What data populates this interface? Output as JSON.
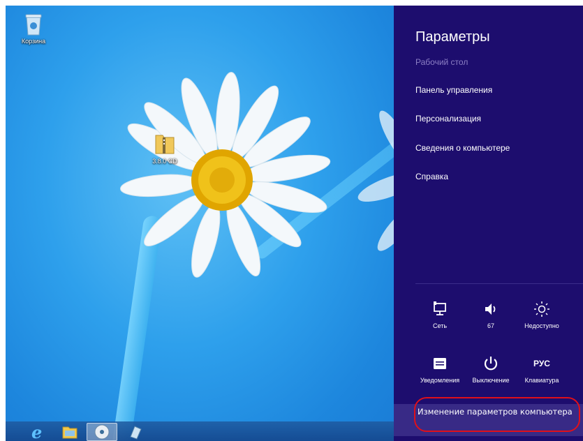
{
  "desktop": {
    "icons": [
      {
        "label": "Корзина"
      },
      {
        "label": "3.8.0 CD"
      }
    ]
  },
  "charm": {
    "title": "Параметры",
    "context": "Рабочий стол",
    "links": [
      "Панель управления",
      "Персонализация",
      "Сведения о компьютере",
      "Справка"
    ],
    "tiles": [
      {
        "label": "Сеть",
        "icon": "network-icon"
      },
      {
        "label": "67",
        "icon": "volume-icon"
      },
      {
        "label": "Недоступно",
        "icon": "brightness-icon"
      },
      {
        "label": "Уведомления",
        "icon": "notifications-icon"
      },
      {
        "label": "Выключение",
        "icon": "power-icon"
      },
      {
        "label": "Клавиатура",
        "icon": "keyboard-icon",
        "glyph": "РУС"
      }
    ],
    "change_settings": "Изменение параметров компьютера"
  },
  "colors": {
    "charm_bg": "#1d0d6e",
    "charm_bottom": "#382a86",
    "highlight": "#e0101a",
    "desktop_blue": "#2ea0ec"
  }
}
